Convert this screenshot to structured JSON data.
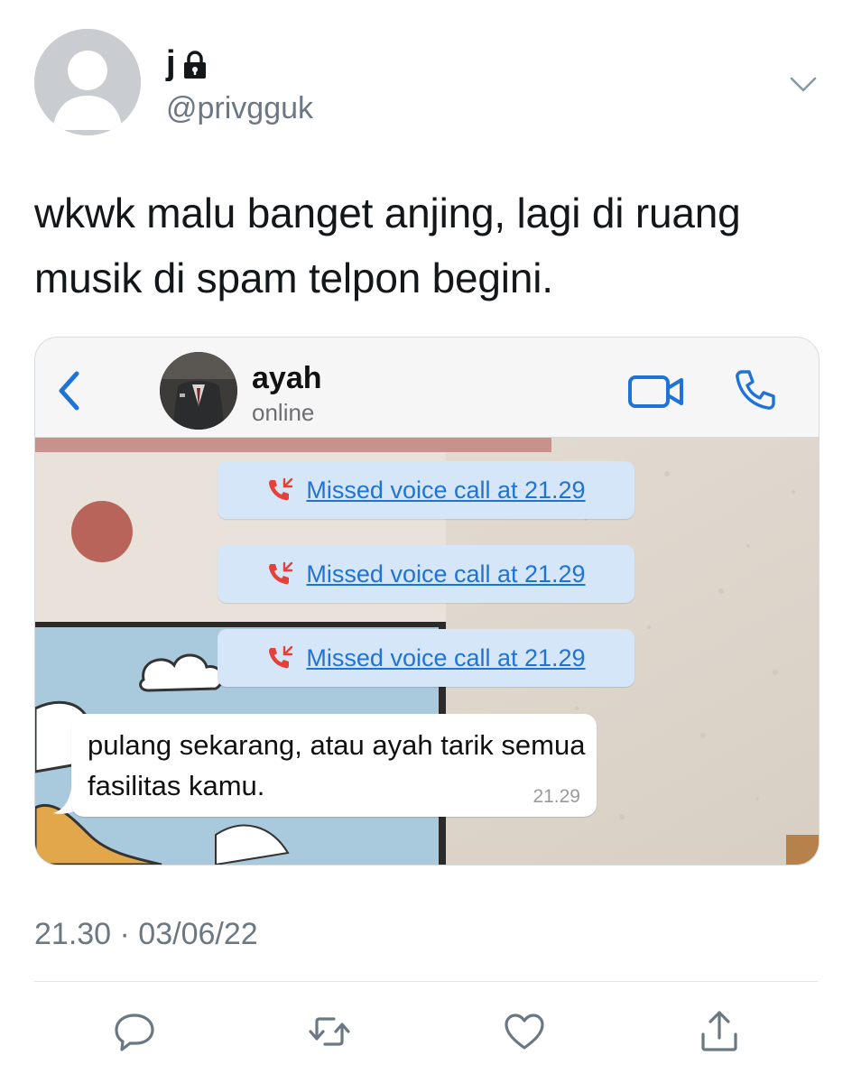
{
  "tweet": {
    "display_name": "j",
    "handle": "@privgguk",
    "text": "wkwk malu banget anjing, lagi di ruang musik di spam telpon begini.",
    "timestamp": "21.30 · 03/06/22",
    "icons": {
      "lock": "lock-icon",
      "menu": "chevron-down-icon",
      "reply": "reply-icon",
      "retweet": "retweet-icon",
      "like": "heart-icon",
      "share": "share-icon"
    }
  },
  "chat": {
    "contact_name": "ayah",
    "contact_status": "online",
    "missed_calls": [
      "Missed voice call at 21.29",
      "Missed voice call at 21.29",
      "Missed voice call at 21.29"
    ],
    "message": {
      "text": "pulang sekarang, atau ayah tarik semua fasilitas kamu.",
      "time": "21.29"
    },
    "icons": {
      "back": "chevron-left-icon",
      "video": "video-call-icon",
      "phone": "phone-icon",
      "missed": "missed-call-icon"
    }
  },
  "colors": {
    "accent_blue": "#1f73d6",
    "missed_red": "#e5403a",
    "call_bubble": "#d4e6f7",
    "muted_text": "#6b7884"
  }
}
